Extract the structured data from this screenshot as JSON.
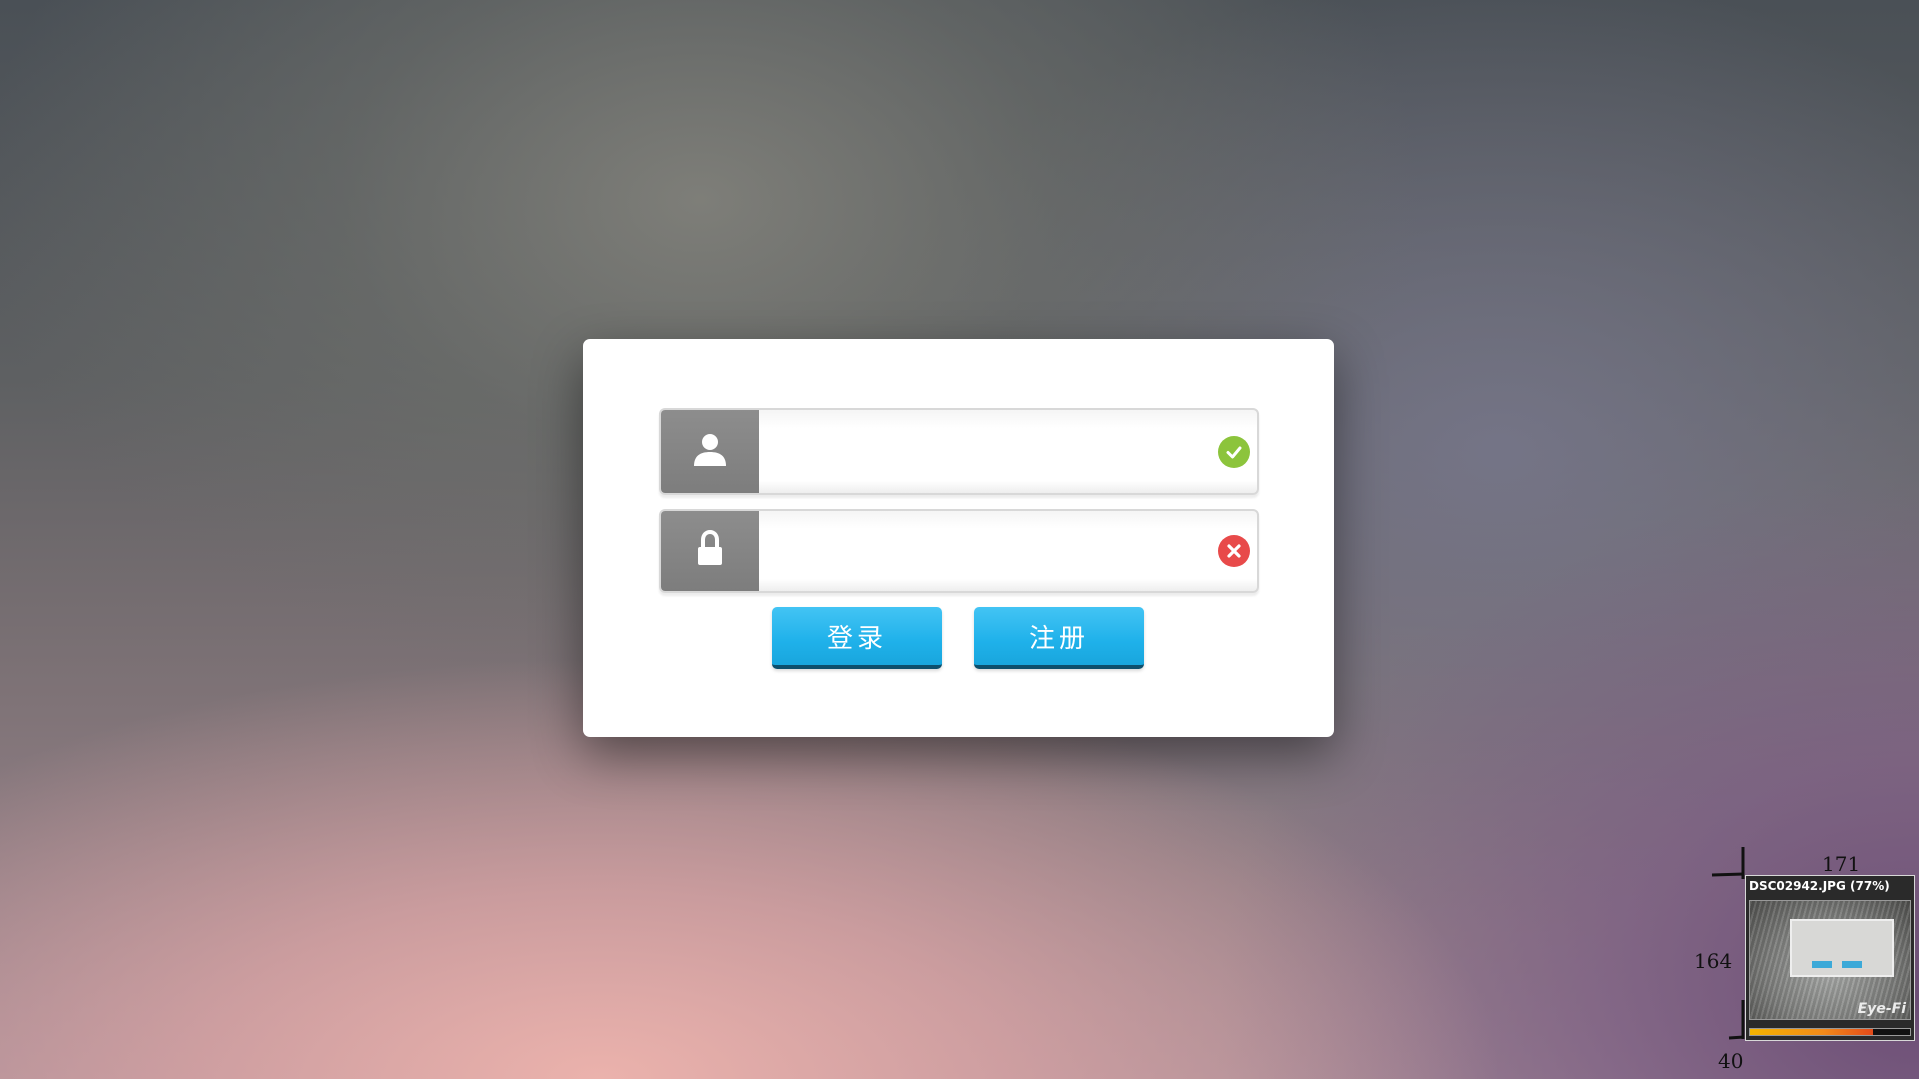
{
  "login_form": {
    "username": {
      "icon": "user-icon",
      "value": "",
      "status": "valid",
      "status_icon": "check-circle-icon",
      "status_color": "#8cc43c"
    },
    "password": {
      "icon": "lock-icon",
      "value": "",
      "status": "invalid",
      "status_icon": "close-circle-icon",
      "status_color": "#e84a4a"
    },
    "login_label": "登录",
    "register_label": "注册",
    "button_color": "#1fb1ea"
  },
  "overlay": {
    "dim_width": "171",
    "dim_height": "164",
    "dim_offset": "40",
    "eyefi": {
      "title": "DSC02942.JPG (77%)",
      "brand": "Eye-Fi",
      "progress": 0.77
    }
  }
}
